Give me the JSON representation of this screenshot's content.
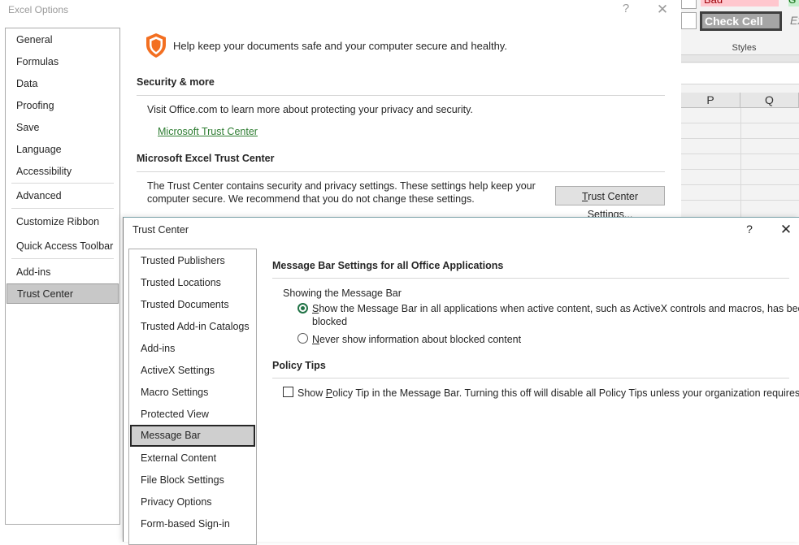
{
  "excel_bg": {
    "style_bad": "Bad",
    "style_good": "G",
    "style_check": "Check Cell",
    "style_explanatory": "Ex",
    "styles_group_label": "Styles",
    "columns": [
      "P",
      "Q"
    ]
  },
  "excel_options": {
    "title": "Excel Options",
    "help": "?",
    "close": "✕",
    "nav": [
      "General",
      "Formulas",
      "Data",
      "Proofing",
      "Save",
      "Language",
      "Accessibility",
      "Advanced",
      "Customize Ribbon",
      "Quick Access Toolbar",
      "Add-ins",
      "Trust Center"
    ],
    "selected_nav": "Trust Center",
    "headline": "Help keep your documents safe and your computer secure and healthy.",
    "security_heading": "Security & more",
    "security_text": "Visit Office.com to learn more about protecting your privacy and security.",
    "security_link": "Microsoft Trust Center",
    "tc_heading": "Microsoft Excel Trust Center",
    "tc_text_line1": "The Trust Center contains security and privacy settings. These settings help keep your",
    "tc_text_line2": "computer secure. We recommend that you do not change these settings.",
    "tc_button_accel": "T",
    "tc_button_rest": "rust Center Settings..."
  },
  "trust_center": {
    "title": "Trust Center",
    "help": "?",
    "close": "✕",
    "nav": [
      "Trusted Publishers",
      "Trusted Locations",
      "Trusted Documents",
      "Trusted Add-in Catalogs",
      "Add-ins",
      "ActiveX Settings",
      "Macro Settings",
      "Protected View",
      "Message Bar",
      "External Content",
      "File Block Settings",
      "Privacy Options",
      "Form-based Sign-in"
    ],
    "selected_nav": "Message Bar",
    "msgbar_heading": "Message Bar Settings for all Office Applications",
    "showing_label": "Showing the Message Bar",
    "option1_accel": "S",
    "option1_rest_line1": "how the Message Bar in all applications when active content, such as ActiveX controls and macros, has been",
    "option1_line2": "blocked",
    "option1_checked": true,
    "option2_accel": "N",
    "option2_rest": "ever show information about blocked content",
    "option2_checked": false,
    "policy_heading": "Policy Tips",
    "policy_pre": "Show ",
    "policy_accel": "P",
    "policy_rest": "olicy Tip in the Message Bar. Turning this off will disable all Policy Tips unless your organization requires it.",
    "policy_checked": false
  },
  "colors": {
    "shield_orange": "#f36f21",
    "accent_green": "#217346",
    "link_green": "#2e7d32",
    "selection_gray": "#c8c8c8"
  }
}
